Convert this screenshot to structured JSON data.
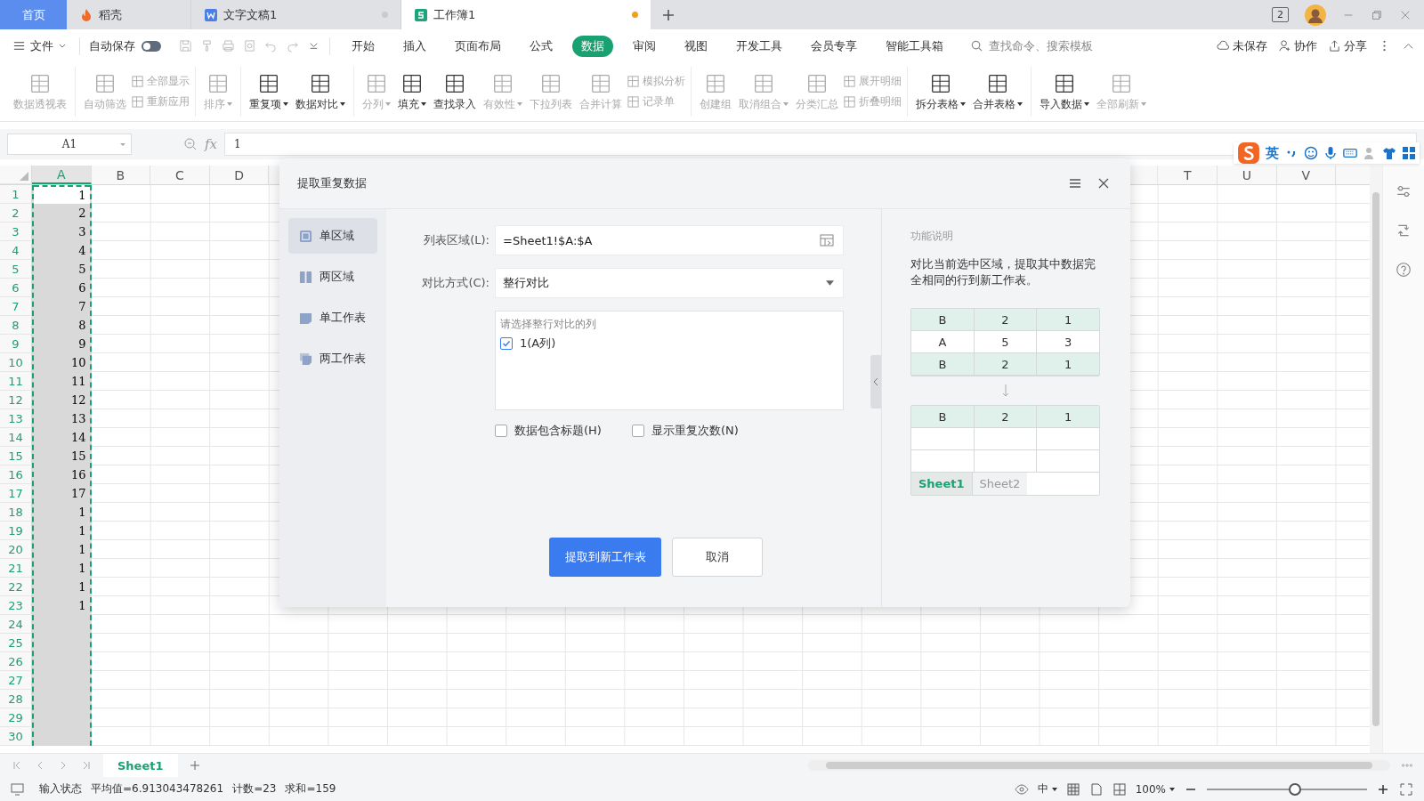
{
  "tabs": [
    {
      "label": "首页",
      "kind": "home",
      "selected": false
    },
    {
      "label": "稻壳",
      "kind": "docer",
      "selected": false
    },
    {
      "label": "文字文稿1",
      "kind": "writer",
      "selected": false,
      "modified": false
    },
    {
      "label": "工作簿1",
      "kind": "sheet",
      "selected": true,
      "modified": true
    }
  ],
  "title_bar": {
    "badge": "2"
  },
  "menu": {
    "file": "文件",
    "autosave": {
      "label": "自动保存",
      "on": false
    },
    "tabs": [
      {
        "label": "开始",
        "selected": false
      },
      {
        "label": "插入",
        "selected": false
      },
      {
        "label": "页面布局",
        "selected": false
      },
      {
        "label": "公式",
        "selected": false
      },
      {
        "label": "数据",
        "selected": true
      },
      {
        "label": "审阅",
        "selected": false
      },
      {
        "label": "视图",
        "selected": false
      },
      {
        "label": "开发工具",
        "selected": false
      },
      {
        "label": "会员专享",
        "selected": false
      },
      {
        "label": "智能工具箱",
        "selected": false
      }
    ],
    "search": {
      "placeholder": "查找命令、搜索模板"
    },
    "actions": [
      "未保存",
      "协作",
      "分享"
    ]
  },
  "ribbon": {
    "groups": [
      {
        "items": [
          {
            "kind": "large",
            "label": "数据透视表",
            "disabled": true,
            "dropdown": false
          }
        ]
      },
      {
        "items": [
          {
            "kind": "large",
            "label": "自动筛选",
            "disabled": true,
            "dropdown": false
          },
          {
            "kind": "stack",
            "items": [
              {
                "label": "全部显示",
                "disabled": true
              },
              {
                "label": "重新应用",
                "disabled": true
              }
            ]
          }
        ]
      },
      {
        "items": [
          {
            "kind": "large",
            "label": "排序",
            "disabled": true,
            "dropdown": true
          }
        ]
      },
      {
        "items": [
          {
            "kind": "large",
            "label": "重复项",
            "disabled": false,
            "dropdown": true
          },
          {
            "kind": "large",
            "label": "数据对比",
            "disabled": false,
            "dropdown": true
          }
        ]
      },
      {
        "items": [
          {
            "kind": "large",
            "label": "分列",
            "disabled": true,
            "dropdown": true
          },
          {
            "kind": "large",
            "label": "填充",
            "disabled": false,
            "dropdown": true
          },
          {
            "kind": "large",
            "label": "查找录入",
            "disabled": false,
            "dropdown": false
          },
          {
            "kind": "large",
            "label": "有效性",
            "disabled": true,
            "dropdown": true
          },
          {
            "kind": "large",
            "label": "下拉列表",
            "disabled": true,
            "dropdown": false
          },
          {
            "kind": "large",
            "label": "合并计算",
            "disabled": true,
            "dropdown": false
          },
          {
            "kind": "stack",
            "items": [
              {
                "label": "模拟分析",
                "disabled": true
              },
              {
                "label": "记录单",
                "disabled": true
              }
            ]
          }
        ]
      },
      {
        "items": [
          {
            "kind": "large",
            "label": "创建组",
            "disabled": true,
            "dropdown": false
          },
          {
            "kind": "large",
            "label": "取消组合",
            "disabled": true,
            "dropdown": true
          },
          {
            "kind": "large",
            "label": "分类汇总",
            "disabled": true,
            "dropdown": false
          },
          {
            "kind": "stack",
            "items": [
              {
                "label": "展开明细",
                "disabled": true
              },
              {
                "label": "折叠明细",
                "disabled": true
              }
            ]
          }
        ]
      },
      {
        "items": [
          {
            "kind": "large",
            "label": "拆分表格",
            "disabled": false,
            "dropdown": true
          },
          {
            "kind": "large",
            "label": "合并表格",
            "disabled": false,
            "dropdown": true
          }
        ]
      },
      {
        "items": [
          {
            "kind": "large",
            "label": "导入数据",
            "disabled": false,
            "dropdown": true
          },
          {
            "kind": "large",
            "label": "全部刷新",
            "disabled": true,
            "dropdown": true
          }
        ]
      }
    ]
  },
  "formula_bar": {
    "name_box": "A1",
    "fx": "fx",
    "value": "1"
  },
  "ime": {
    "label": "英"
  },
  "sheet": {
    "columns_left": [
      {
        "label": "A",
        "selected": true
      },
      {
        "label": "B",
        "selected": false
      },
      {
        "label": "C",
        "selected": false
      },
      {
        "label": "D",
        "selected": false
      }
    ],
    "columns_right": [
      {
        "label": "T",
        "selected": false
      },
      {
        "label": "U",
        "selected": false
      },
      {
        "label": "V",
        "selected": false
      }
    ],
    "rows": [
      {
        "number": "1",
        "value": "1"
      },
      {
        "number": "2",
        "value": "2"
      },
      {
        "number": "3",
        "value": "3"
      },
      {
        "number": "4",
        "value": "4"
      },
      {
        "number": "5",
        "value": "5"
      },
      {
        "number": "6",
        "value": "6"
      },
      {
        "number": "7",
        "value": "7"
      },
      {
        "number": "8",
        "value": "8"
      },
      {
        "number": "9",
        "value": "9"
      },
      {
        "number": "10",
        "value": "10"
      },
      {
        "number": "11",
        "value": "11"
      },
      {
        "number": "12",
        "value": "12"
      },
      {
        "number": "13",
        "value": "13"
      },
      {
        "number": "14",
        "value": "14"
      },
      {
        "number": "15",
        "value": "15"
      },
      {
        "number": "16",
        "value": "16"
      },
      {
        "number": "17",
        "value": "17"
      },
      {
        "number": "18",
        "value": "1"
      },
      {
        "number": "19",
        "value": "1"
      },
      {
        "number": "20",
        "value": "1"
      },
      {
        "number": "21",
        "value": "1"
      },
      {
        "number": "22",
        "value": "1"
      },
      {
        "number": "23",
        "value": "1"
      },
      {
        "number": "24"
      },
      {
        "number": "25"
      },
      {
        "number": "26"
      },
      {
        "number": "27"
      },
      {
        "number": "28"
      },
      {
        "number": "29"
      },
      {
        "number": "30"
      }
    ]
  },
  "sheet_tabs": [
    {
      "label": "Sheet1",
      "selected": true
    }
  ],
  "status": {
    "mode": "输入状态",
    "stats": [
      "平均值=6.913043478261",
      "计数=23",
      "求和=159"
    ],
    "input_lang": "中",
    "zoom": "100%",
    "zoom_slider": {
      "level": 0.55
    }
  },
  "dialog": {
    "title": "提取重复数据",
    "nav": [
      {
        "label": "单区域",
        "selected": true
      },
      {
        "label": "两区域",
        "selected": false
      },
      {
        "label": "单工作表",
        "selected": false
      },
      {
        "label": "两工作表",
        "selected": false
      }
    ],
    "range": {
      "label": "列表区域(L):",
      "value": "=Sheet1!$A:$A"
    },
    "compare": {
      "label": "对比方式(C):",
      "value": "整行对比"
    },
    "column_list": {
      "hint": "请选择整行对比的列",
      "items": [
        {
          "label": "1(A列)",
          "checked": true
        }
      ]
    },
    "options": [
      {
        "label": "数据包含标题(H)",
        "checked": false
      },
      {
        "label": "显示重复次数(N)",
        "checked": false
      }
    ],
    "buttons": [
      {
        "label": "提取到新工作表",
        "kind": "primary"
      },
      {
        "label": "取消",
        "kind": "secondary"
      }
    ],
    "help": {
      "title": "功能说明",
      "text": "对比当前选中区域，提取其中数据完全相同的行到新工作表。",
      "before": [
        {
          "cells": [
            "B",
            "2",
            "1"
          ],
          "highlighted": true
        },
        {
          "cells": [
            "A",
            "5",
            "3"
          ],
          "highlighted": false
        },
        {
          "cells": [
            "B",
            "2",
            "1"
          ],
          "highlighted": true
        }
      ],
      "after": [
        {
          "cells": [
            "B",
            "2",
            "1"
          ],
          "highlighted": true
        }
      ],
      "sheets": [
        {
          "label": "Sheet1",
          "selected": true
        },
        {
          "label": "Sheet2",
          "selected": false
        }
      ]
    }
  }
}
